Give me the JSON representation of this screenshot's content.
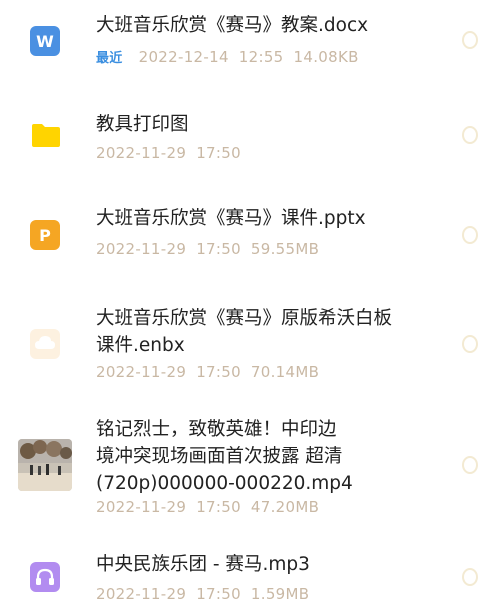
{
  "files": [
    {
      "name": "大班音乐欣赏《赛马》教案.docx",
      "recent": "最近",
      "date": "2022-12-14",
      "time": "12:55",
      "size": "14.08KB",
      "icon": "word-doc-icon",
      "glyph": "W"
    },
    {
      "name": "教具打印图",
      "date": "2022-11-29",
      "time": "17:50",
      "icon": "folder-icon"
    },
    {
      "name": "大班音乐欣赏《赛马》课件.pptx",
      "date": "2022-11-29",
      "time": "17:50",
      "size": "59.55MB",
      "icon": "powerpoint-icon",
      "glyph": "P"
    },
    {
      "name_line1": "大班音乐欣赏《赛马》原版希沃白板",
      "name_line2": "课件.enbx",
      "date": "2022-11-29",
      "time": "17:50",
      "size": "70.14MB",
      "icon": "cloud-icon"
    },
    {
      "name_line1": "铭记烈士，致敬英雄！中印边",
      "name_line2": "境冲突现场画面首次披露 超清",
      "name_line3": "(720p)000000-000220.mp4",
      "date": "2022-11-29",
      "time": "17:50",
      "size": "47.20MB",
      "icon": "video-thumbnail"
    },
    {
      "name": "中央民族乐团 - 赛马.mp3",
      "date": "2022-11-29",
      "time": "17:50",
      "size": "1.59MB",
      "icon": "headphones-icon"
    }
  ]
}
